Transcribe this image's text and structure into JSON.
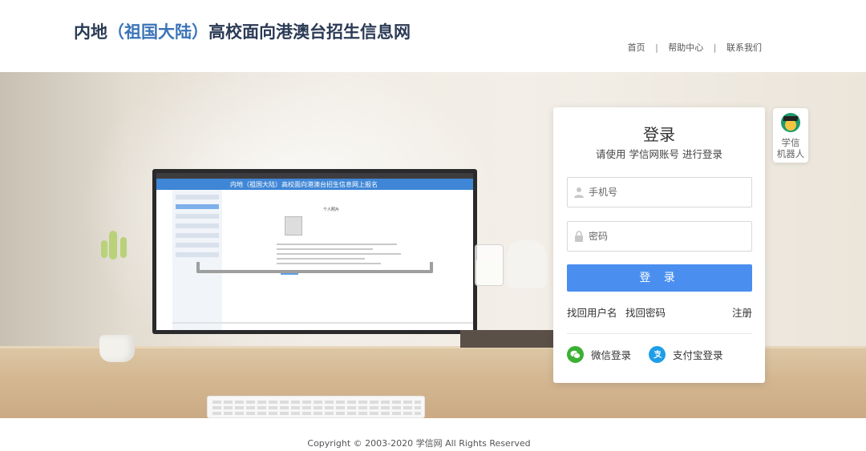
{
  "header": {
    "title_prefix": "内地",
    "title_accent": "（祖国大陆）",
    "title_suffix": "高校面向港澳台招生信息网",
    "nav": [
      {
        "label": "首页"
      },
      {
        "label": "帮助中心"
      },
      {
        "label": "联系我们"
      }
    ],
    "nav_separator": "|"
  },
  "monitor_screen": {
    "title": "内地（祖国大陆）高校面向港澳台招生信息网上报名",
    "heading": "个人照片"
  },
  "login": {
    "title": "登录",
    "subtitle": "请使用 学信网账号 进行登录",
    "phone": {
      "placeholder": "手机号",
      "value": "",
      "icon": "user-icon"
    },
    "password": {
      "placeholder": "密码",
      "value": "",
      "icon": "lock-icon"
    },
    "submit_label": "登 录",
    "links": {
      "find_username": "找回用户名",
      "find_password": "找回密码",
      "register": "注册"
    },
    "social": {
      "wechat": {
        "label": "微信登录",
        "icon": "wechat-icon",
        "color": "#3cb034"
      },
      "alipay": {
        "label": "支付宝登录",
        "icon": "alipay-icon",
        "color": "#1e9ee8"
      }
    },
    "accent_color": "#4a8ff0"
  },
  "robot": {
    "label_line1": "学信",
    "label_line2": "机器人",
    "icon": "robot-avatar-icon"
  },
  "footer": {
    "copyright": "Copyright © 2003-2020 学信网 All Rights Reserved"
  }
}
